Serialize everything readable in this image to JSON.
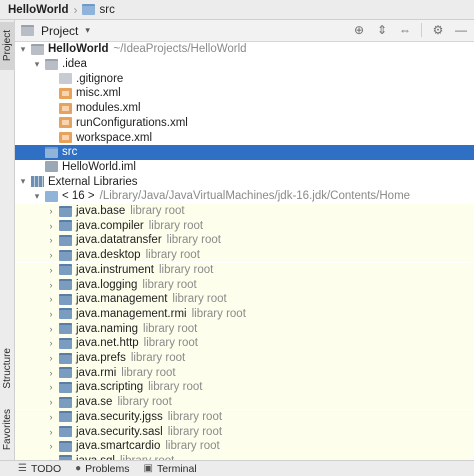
{
  "breadcrumb": {
    "project": "HelloWorld",
    "folder": "src"
  },
  "left_tabs": {
    "project": "Project",
    "structure": "Structure",
    "favorites": "Favorites"
  },
  "project_panel": {
    "title": "Project"
  },
  "tree": {
    "root": {
      "name": "HelloWorld",
      "path": "~/IdeaProjects/HelloWorld"
    },
    "idea": {
      "name": ".idea"
    },
    "idea_files": [
      ".gitignore",
      "misc.xml",
      "modules.xml",
      "runConfigurations.xml",
      "workspace.xml"
    ],
    "src": {
      "name": "src"
    },
    "iml": {
      "name": "HelloWorld.iml"
    },
    "external": {
      "name": "External Libraries"
    },
    "jdk": {
      "name": "< 16 >",
      "path": "/Library/Java/JavaVirtualMachines/jdk-16.jdk/Contents/Home"
    },
    "library_root_label": "library root",
    "modules": [
      "java.base",
      "java.compiler",
      "java.datatransfer",
      "java.desktop",
      "java.instrument",
      "java.logging",
      "java.management",
      "java.management.rmi",
      "java.naming",
      "java.net.http",
      "java.prefs",
      "java.rmi",
      "java.scripting",
      "java.se",
      "java.security.jgss",
      "java.security.sasl",
      "java.smartcardio",
      "java.sql"
    ]
  },
  "bottom_bar": {
    "todo": "TODO",
    "problems": "Problems",
    "terminal": "Terminal"
  },
  "colors": {
    "selection": "#2f6fc4",
    "library_background": "#fefeec"
  }
}
